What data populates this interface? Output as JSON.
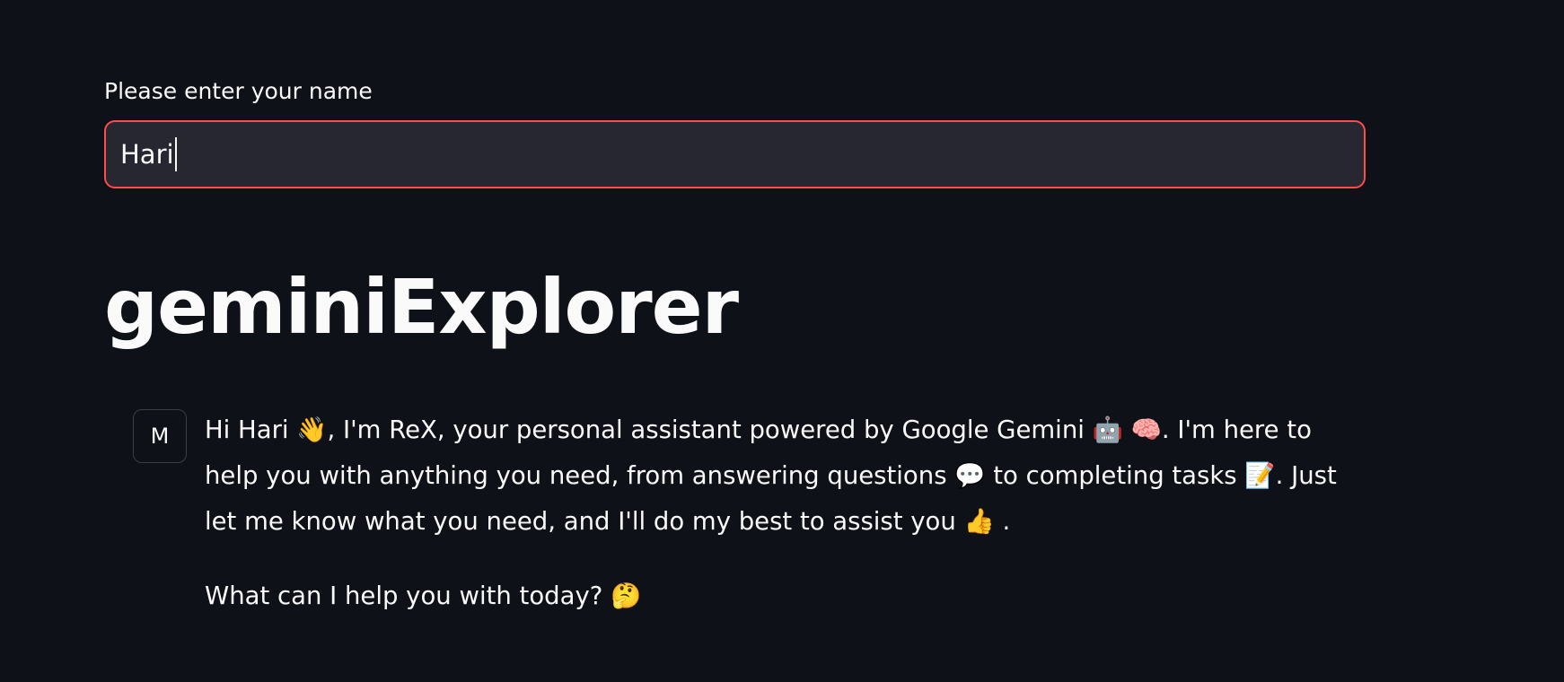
{
  "name_field": {
    "label": "Please enter your name",
    "value": "Hari"
  },
  "title": "geminiExplorer",
  "chat": {
    "avatar_initial": "M",
    "paragraph1": {
      "s1": "Hi Hari ",
      "e1": "👋",
      "s2": ", I'm ReX, your personal assistant powered by Google Gemini ",
      "e2": "🤖",
      "s3": " ",
      "e3": "🧠",
      "s4": ". I'm here to help you with anything you need, from answering questions ",
      "e4": "💬",
      "s5": " to completing tasks ",
      "e5": "📝",
      "s6": ". Just let me know what you need, and I'll do my best to assist you ",
      "e6": "👍",
      "s7": " ."
    },
    "paragraph2": {
      "s1": "What can I help you with today? ",
      "e1": "🤔"
    }
  },
  "colors": {
    "background": "#0e1117",
    "input_background": "#262730",
    "input_border_focus": "#ff4b4b",
    "text": "#fafafa"
  }
}
